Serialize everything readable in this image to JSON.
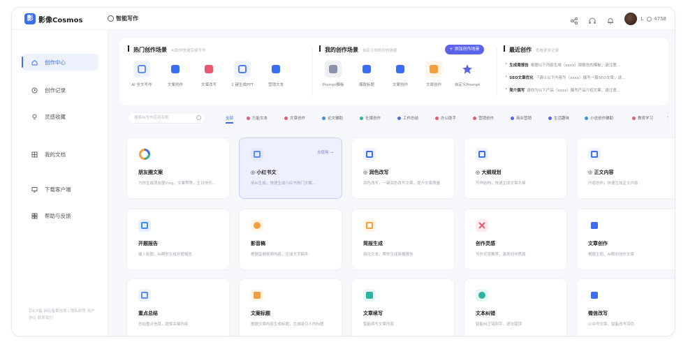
{
  "app": {
    "logo_text": "影像Cosmos",
    "logo_mark": "影"
  },
  "header": {
    "breadcrumb": "智能写作",
    "user_name": "L",
    "points": "4758"
  },
  "colors": {
    "accent": "#3a6df0",
    "button": "#5b63e8",
    "selected_card": "#eef0fd"
  },
  "sidebar": {
    "items": [
      {
        "label": "创作中心",
        "icon": "home-icon",
        "active": true
      },
      {
        "label": "创作记录",
        "icon": "history-icon",
        "active": false
      },
      {
        "label": "灵感收藏",
        "icon": "bulb-icon",
        "active": false
      },
      {
        "label": "我的文档",
        "icon": "document-icon",
        "active": false
      },
      {
        "label": "下载客户端",
        "icon": "monitor-icon",
        "active": false
      },
      {
        "label": "帮助与反馈",
        "icon": "help-icon",
        "active": false
      }
    ],
    "footer": "京ICP备 网站备案信息 | 隐私政策 用户协议 联系我们"
  },
  "hot_scenes": {
    "title": "热门创作场景",
    "subtitle": "AI助你快速完成写作",
    "tools": [
      {
        "label": "AI 全文写作",
        "color": "#5b8def"
      },
      {
        "label": "文案创作",
        "color": "#3a6df0"
      },
      {
        "label": "文章改写",
        "color": "#e8586e"
      },
      {
        "label": "1 键生成PPT",
        "color": "#4b7ef0"
      },
      {
        "label": "营销文本",
        "color": "#3a6df0"
      }
    ]
  },
  "my_scenes": {
    "title": "我的创作场景",
    "subtitle": "自定义你的创作场景",
    "button": "+ 添加创作场景",
    "tools": [
      {
        "label": "Prompt模板",
        "color": "#8a93a8"
      },
      {
        "label": "爆款标题",
        "color": "#3a6df0"
      },
      {
        "label": "文案创作",
        "color": "#3a6df0"
      },
      {
        "label": "文章创作",
        "color": "#f0a040"
      },
      {
        "label": "自定义Prompt",
        "color": "#5b63e8"
      }
    ]
  },
  "recent": {
    "title": "最近创作",
    "subtitle": "查看更多记录",
    "items": [
      {
        "name": "生成周报告",
        "text": "根据以下内容生成（xxxx）周报告的模板，请注意..."
      },
      {
        "name": "SEO文章优化",
        "text": "「请以以下内容为（xxxx）撰写一篇SEO文章，请..."
      },
      {
        "name": "简介撰写",
        "text": "请你为以下产品（xxxx）撰写产品介绍文案，请注意..."
      }
    ]
  },
  "filters": {
    "search_placeholder": "搜索AI写作应用名称",
    "chips": [
      {
        "label": "全部",
        "color": "",
        "active": true
      },
      {
        "label": "万能文本",
        "color": "#e8586e",
        "active": false
      },
      {
        "label": "文章创作",
        "color": "#e8586e",
        "active": false
      },
      {
        "label": "论文辅助",
        "color": "#3a8def",
        "active": false
      },
      {
        "label": "社媒创作",
        "color": "#2bb5a0",
        "active": false
      },
      {
        "label": "工作总结",
        "color": "#3a6df0",
        "active": false
      },
      {
        "label": "办公助手",
        "color": "#e8586e",
        "active": false
      },
      {
        "label": "营销创作",
        "color": "#e8586e",
        "active": false
      },
      {
        "label": "商业营销",
        "color": "#5b63e8",
        "active": false
      },
      {
        "label": "生活趣味",
        "color": "#5b63e8",
        "active": false
      },
      {
        "label": "小说创作辅助",
        "color": "#3a8def",
        "active": false
      },
      {
        "label": "教育学习",
        "color": "#e8586e",
        "active": false
      }
    ]
  },
  "cards": [
    {
      "title": "朋友圈文案",
      "desc": "为你生成朋友圈Vlog、文案等等，生日快乐...",
      "color": "#f0a040",
      "tag": ""
    },
    {
      "title": "◎ 小红书文",
      "desc": "用AI生成，快速生成小红书热门文案...",
      "color": "#5b8def",
      "tag": "去使用 →"
    },
    {
      "title": "◎ 润色改写",
      "desc": "润色改写，一键润色改写文章，提升文章质量",
      "color": "#3a6df0",
      "tag": ""
    },
    {
      "title": "◎ 大纲规划",
      "desc": "写作结构，快速生成文章大纲",
      "color": "#3a6df0",
      "tag": ""
    },
    {
      "title": "◎ 正文内容",
      "desc": "内容创作，快速生成正文内容",
      "color": "#3a6df0",
      "tag": ""
    },
    {
      "title": "开题报告",
      "desc": "输入标题，AI帮你生成开题报告",
      "color": "#3a8def",
      "tag": ""
    },
    {
      "title": "影音稿",
      "desc": "根据音频视频内容，生成文字稿件",
      "color": "#f0a040",
      "tag": ""
    },
    {
      "title": "简报生成",
      "desc": "简化文本，帮你生成简报报告",
      "color": "#f0a040",
      "tag": ""
    },
    {
      "title": "创作灵感",
      "desc": "写作灵感推荐，激发创作思路",
      "color": "#e8586e",
      "tag": ""
    },
    {
      "title": "文章创作",
      "desc": "根据主题，AI帮你创作文章",
      "color": "#3a6df0",
      "tag": ""
    },
    {
      "title": "重点总结",
      "desc": "总结重点信息，提炼关键内容",
      "color": "#5b8def",
      "tag": ""
    },
    {
      "title": "文案标题",
      "desc": "根据文章内容生成标题，生成吸引人的标题",
      "color": "#f0a040",
      "tag": ""
    },
    {
      "title": "文章续写",
      "desc": "智能续写文章内容",
      "color": "#2bb5a0",
      "tag": ""
    },
    {
      "title": "文本纠错",
      "desc": "智能纠正错别字，语法错误",
      "color": "#2bb5a0",
      "tag": ""
    },
    {
      "title": "微信改写",
      "desc": "公众号文章，智能改写润色",
      "color": "#3a6df0",
      "tag": ""
    }
  ]
}
